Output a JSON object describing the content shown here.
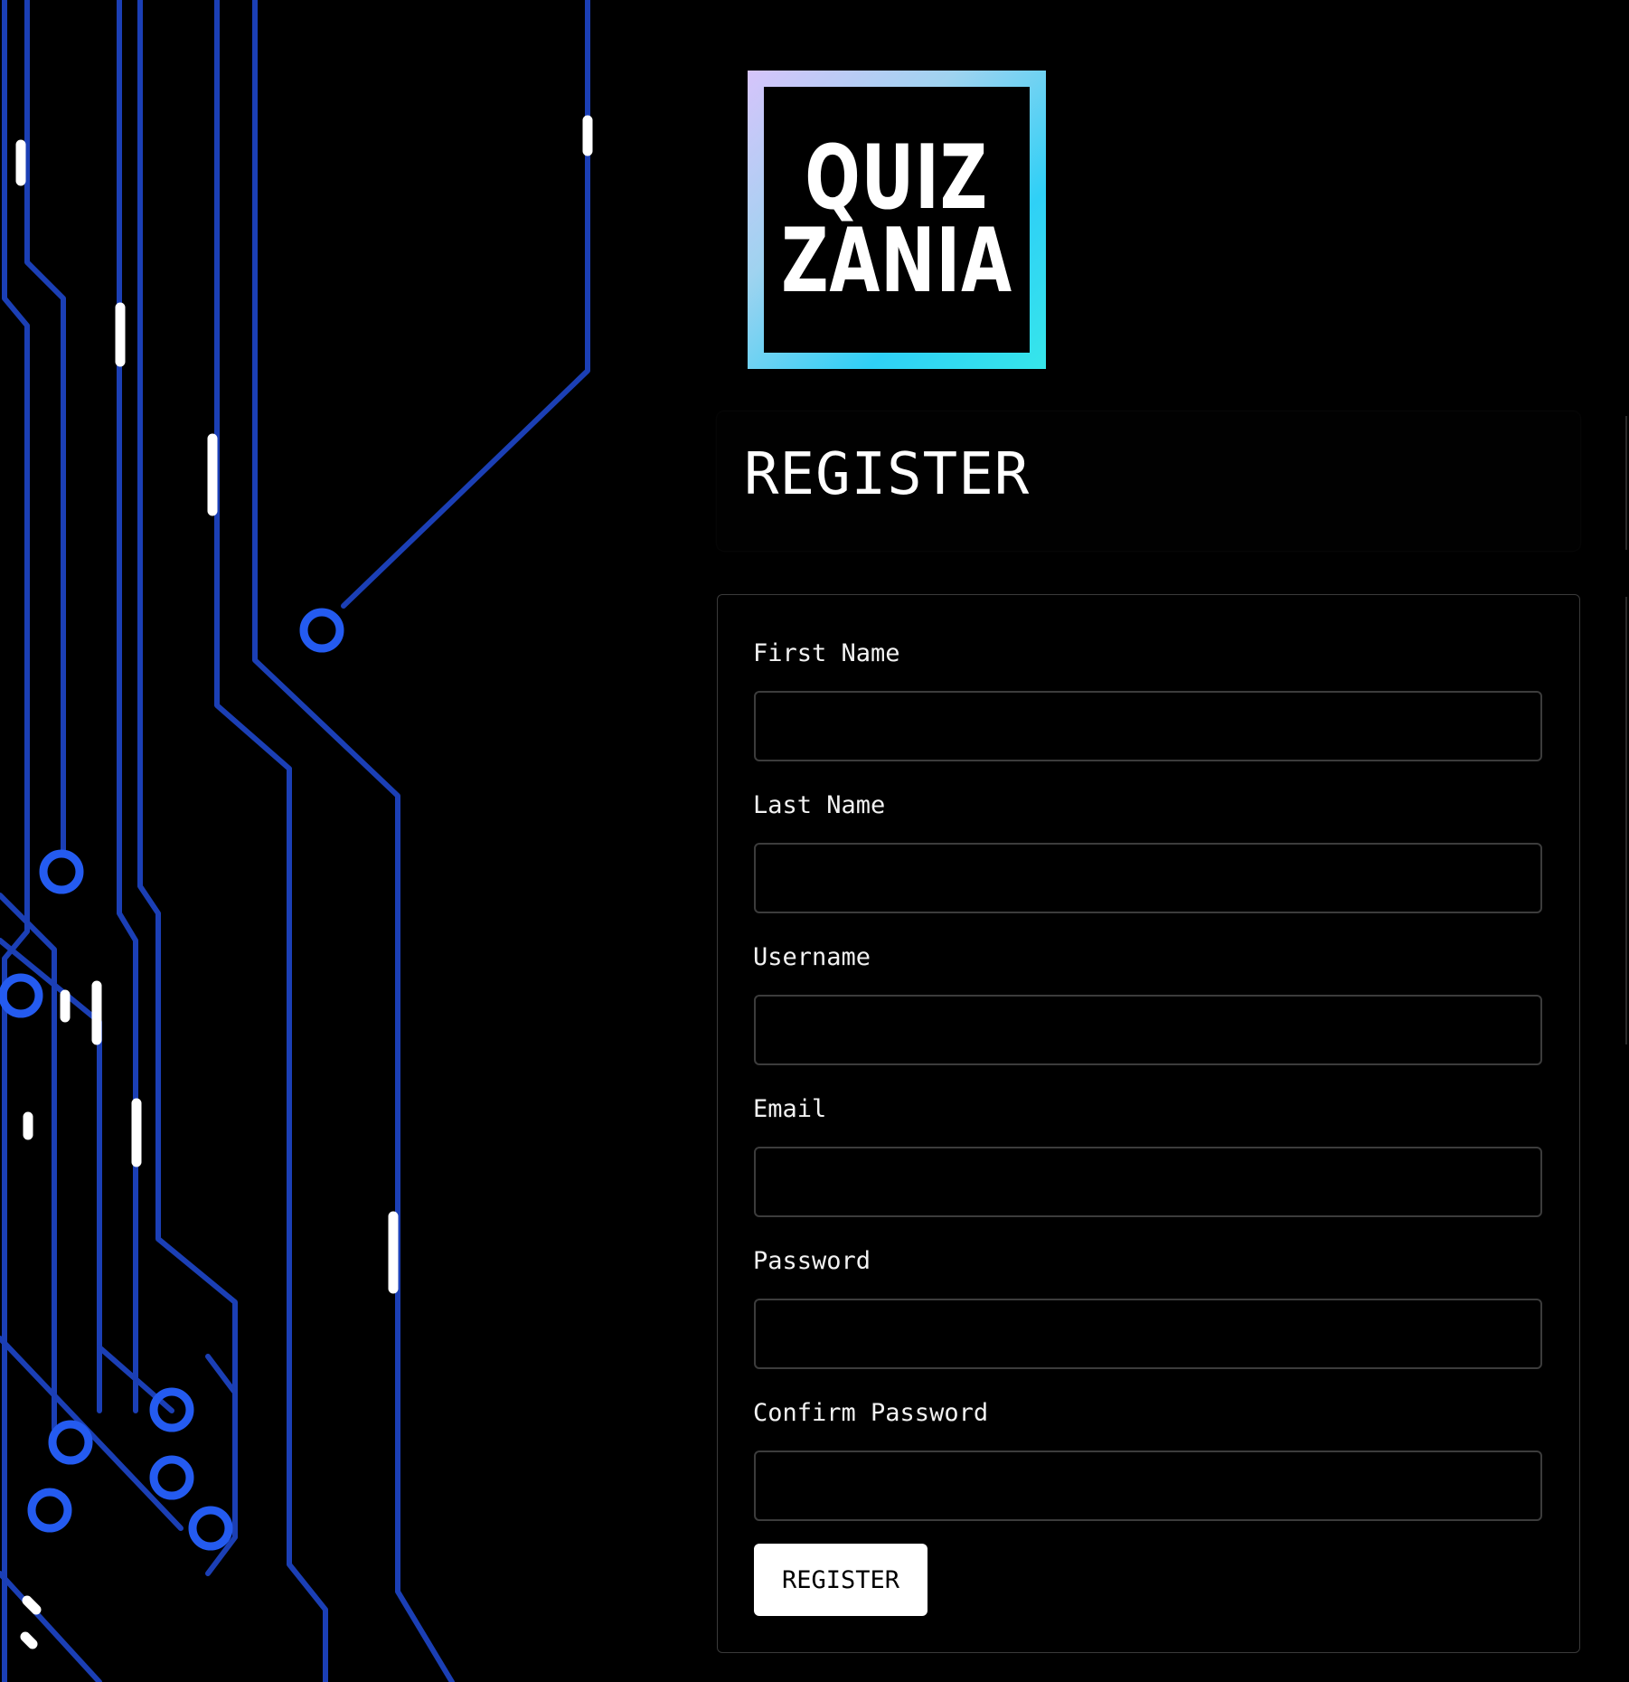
{
  "logo": {
    "line1": "QUIZ",
    "line2": "ZANIA"
  },
  "page_title": "REGISTER",
  "form": {
    "fields": [
      {
        "label": "First Name",
        "value": ""
      },
      {
        "label": "Last Name",
        "value": ""
      },
      {
        "label": "Username",
        "value": ""
      },
      {
        "label": "Email",
        "value": ""
      },
      {
        "label": "Password",
        "value": ""
      },
      {
        "label": "Confirm Password",
        "value": ""
      }
    ],
    "submit_label": "REGISTER"
  },
  "colors": {
    "background": "#000000",
    "circuit_trace": "#1f4fd0",
    "logo_gradient_start": "#d6c4fb",
    "logo_gradient_end": "#36e6ea",
    "button_bg": "#ffffff"
  }
}
